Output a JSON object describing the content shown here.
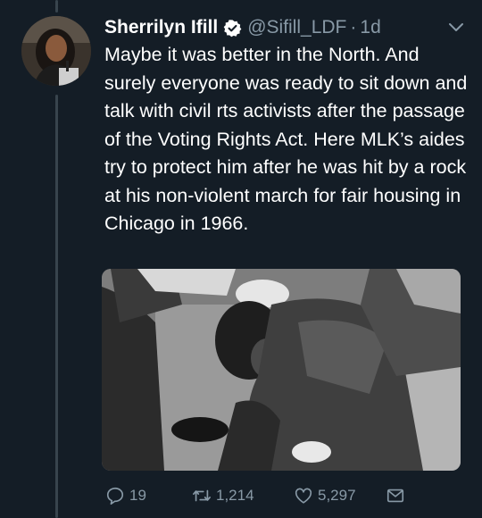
{
  "tweet": {
    "author_name": "Sherrilyn Ifill",
    "handle": "@Sifill_LDF",
    "separator": "·",
    "time": "1d",
    "text": "Maybe it was better in the North. And surely everyone was ready to sit down and talk with civil rts activists after the passage of the Voting Rights Act. Here MLK’s aides try to protect him after he was hit by a rock at his non-violent march for fair housing in Chicago in 1966."
  },
  "actions": {
    "replies": "19",
    "retweets": "1,214",
    "likes": "5,297"
  },
  "icons": {
    "verified": "verified-badge-icon",
    "caret": "chevron-down-icon",
    "reply": "reply-icon",
    "retweet": "retweet-icon",
    "like": "heart-icon",
    "dm": "envelope-icon"
  },
  "colors": {
    "background": "#141d26",
    "text_primary": "#ffffff",
    "text_secondary": "#8899a6",
    "accent": "#1da1f2",
    "thread_line": "#38444d"
  }
}
